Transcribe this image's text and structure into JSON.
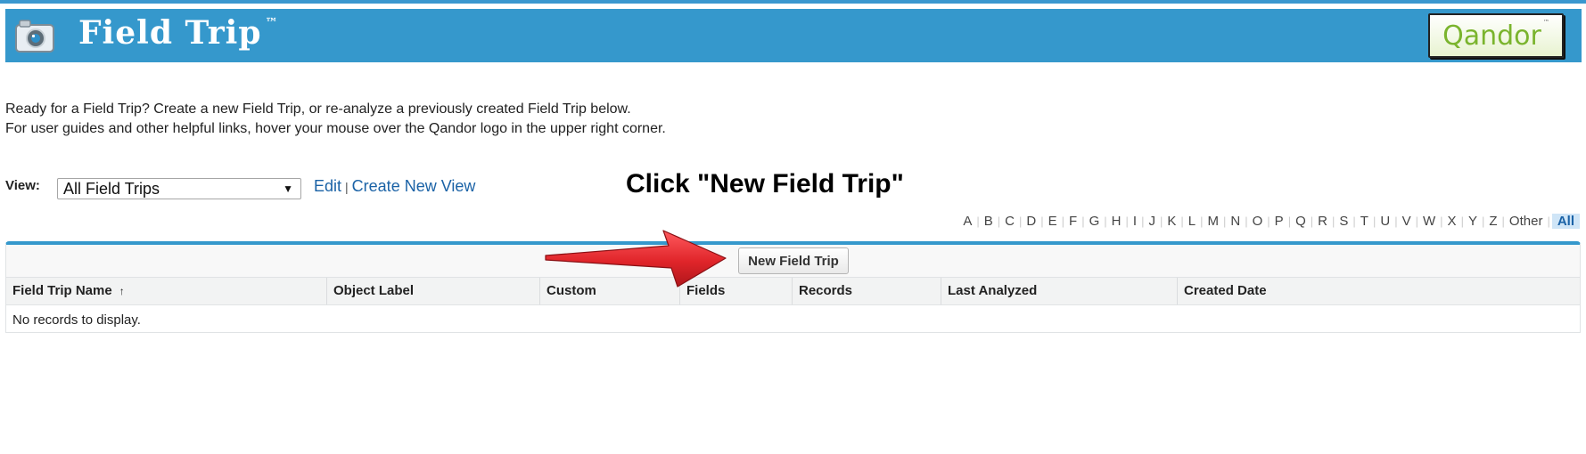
{
  "header": {
    "app_title": "Field Trip",
    "trademark": "™",
    "logo_text": "Qandor",
    "logo_trademark": "™",
    "brand_color": "#3598cc"
  },
  "intro": {
    "line1": "Ready for a Field Trip? Create a new Field Trip, or re-analyze a previously created Field Trip below.",
    "line2": "For user guides and other helpful links, hover your mouse over the Qandor logo in the upper right corner."
  },
  "view": {
    "label": "View:",
    "selected": "All Field Trips",
    "edit_link": "Edit",
    "separator": "|",
    "create_link": "Create New View"
  },
  "callout": "Click \"New Field Trip\"",
  "alpha_filter": {
    "letters": [
      "A",
      "B",
      "C",
      "D",
      "E",
      "F",
      "G",
      "H",
      "I",
      "J",
      "K",
      "L",
      "M",
      "N",
      "O",
      "P",
      "Q",
      "R",
      "S",
      "T",
      "U",
      "V",
      "W",
      "X",
      "Y",
      "Z",
      "Other"
    ],
    "all_label": "All"
  },
  "table": {
    "new_button": "New Field Trip",
    "columns": [
      "Field Trip Name",
      "Object Label",
      "Custom",
      "Fields",
      "Records",
      "Last Analyzed",
      "Created Date"
    ],
    "sort_indicator": "↑",
    "empty_message": "No records to display."
  },
  "icons": {
    "camera": "camera-icon",
    "dropdown": "dropdown-arrow-icon",
    "sort": "sort-ascending-icon",
    "pointer_arrow": "red-arrow-icon"
  },
  "colors": {
    "link": "#1a62a6",
    "arrow": "#e0252a",
    "all_highlight": "#cfe5f7"
  }
}
